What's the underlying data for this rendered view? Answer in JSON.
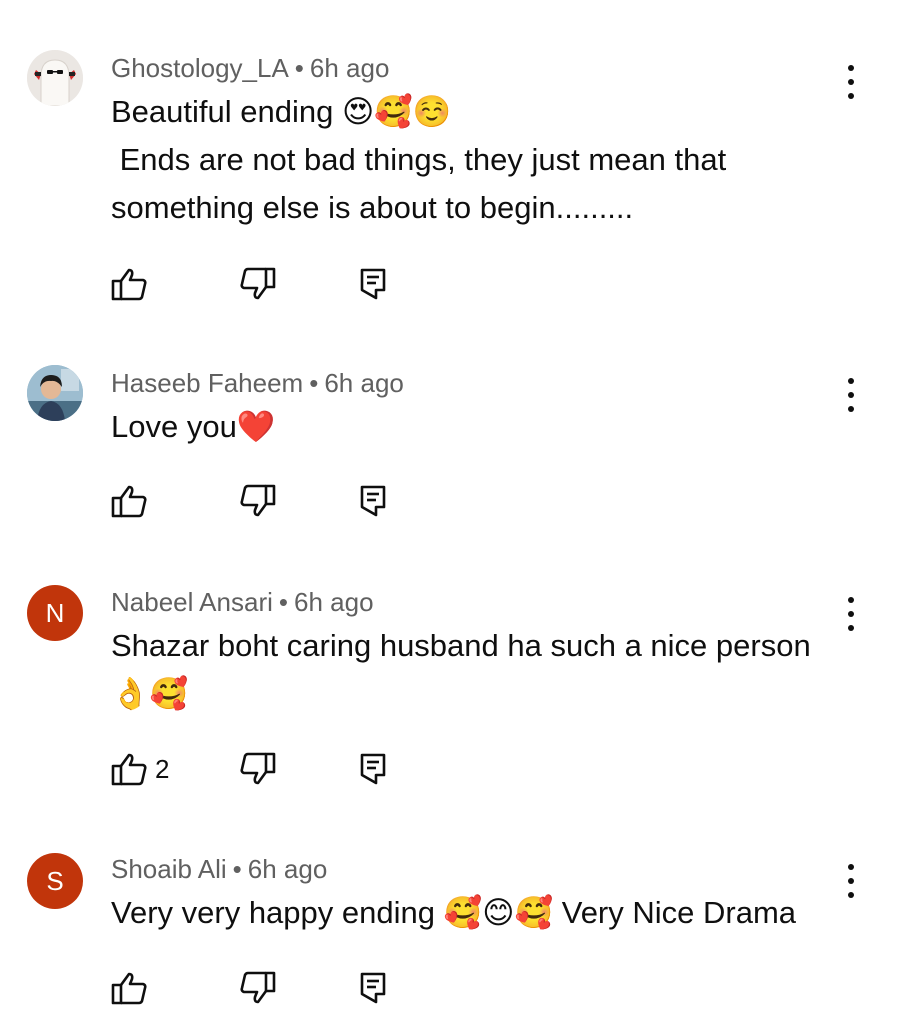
{
  "comments": [
    {
      "author": "Ghostology_LA",
      "time": "6h ago",
      "separator": "•",
      "avatar": {
        "type": "image",
        "icon": "ghost-avatar-image"
      },
      "text": "Beautiful ending 😍🥰☺️\n Ends are not bad things, they just mean that\nsomething else is about to begin.........",
      "likes": ""
    },
    {
      "author": "Haseeb Faheem",
      "time": "6h ago",
      "separator": "•",
      "avatar": {
        "type": "image",
        "icon": "person-photo-avatar"
      },
      "text": "Love you❤️",
      "likes": ""
    },
    {
      "author": "Nabeel Ansari",
      "time": "6h ago",
      "separator": "•",
      "avatar": {
        "type": "letter",
        "letter": "N",
        "color": "#c1350b"
      },
      "text": "Shazar boht caring husband ha such a nice person\n👌🥰",
      "likes": "2"
    },
    {
      "author": "Shoaib Ali",
      "time": "6h ago",
      "separator": "•",
      "avatar": {
        "type": "letter",
        "letter": "S",
        "color": "#c1350b"
      },
      "text": "Very very happy ending 🥰😊🥰 Very Nice Drama",
      "likes": ""
    }
  ],
  "colors": {
    "meta": "#606060",
    "text": "#0f0f0f",
    "avatar_bg": "#c1350b"
  }
}
